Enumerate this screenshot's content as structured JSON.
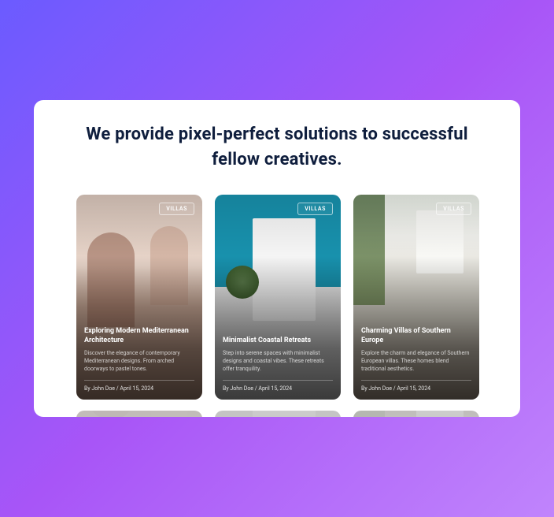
{
  "headline": "We provide pixel-perfect solutions to successful fellow creatives.",
  "badge_label": "VILLAS",
  "cards": [
    {
      "title": "Exploring Modern Mediterranean Architecture",
      "desc": "Discover the elegance of contemporary Mediterranean designs. From arched doorways to pastel tones.",
      "meta": "By John Doe / April 15, 2024"
    },
    {
      "title": "Minimalist Coastal Retreats",
      "desc": "Step into serene spaces with minimalist designs and coastal vibes. These retreats offer tranquility.",
      "meta": "By John Doe / April 15, 2024"
    },
    {
      "title": "Charming Villas of Southern Europe",
      "desc": "Explore the charm and elegance of Southern European villas. These homes blend traditional aesthetics.",
      "meta": "By John Doe / April 15, 2024"
    }
  ]
}
